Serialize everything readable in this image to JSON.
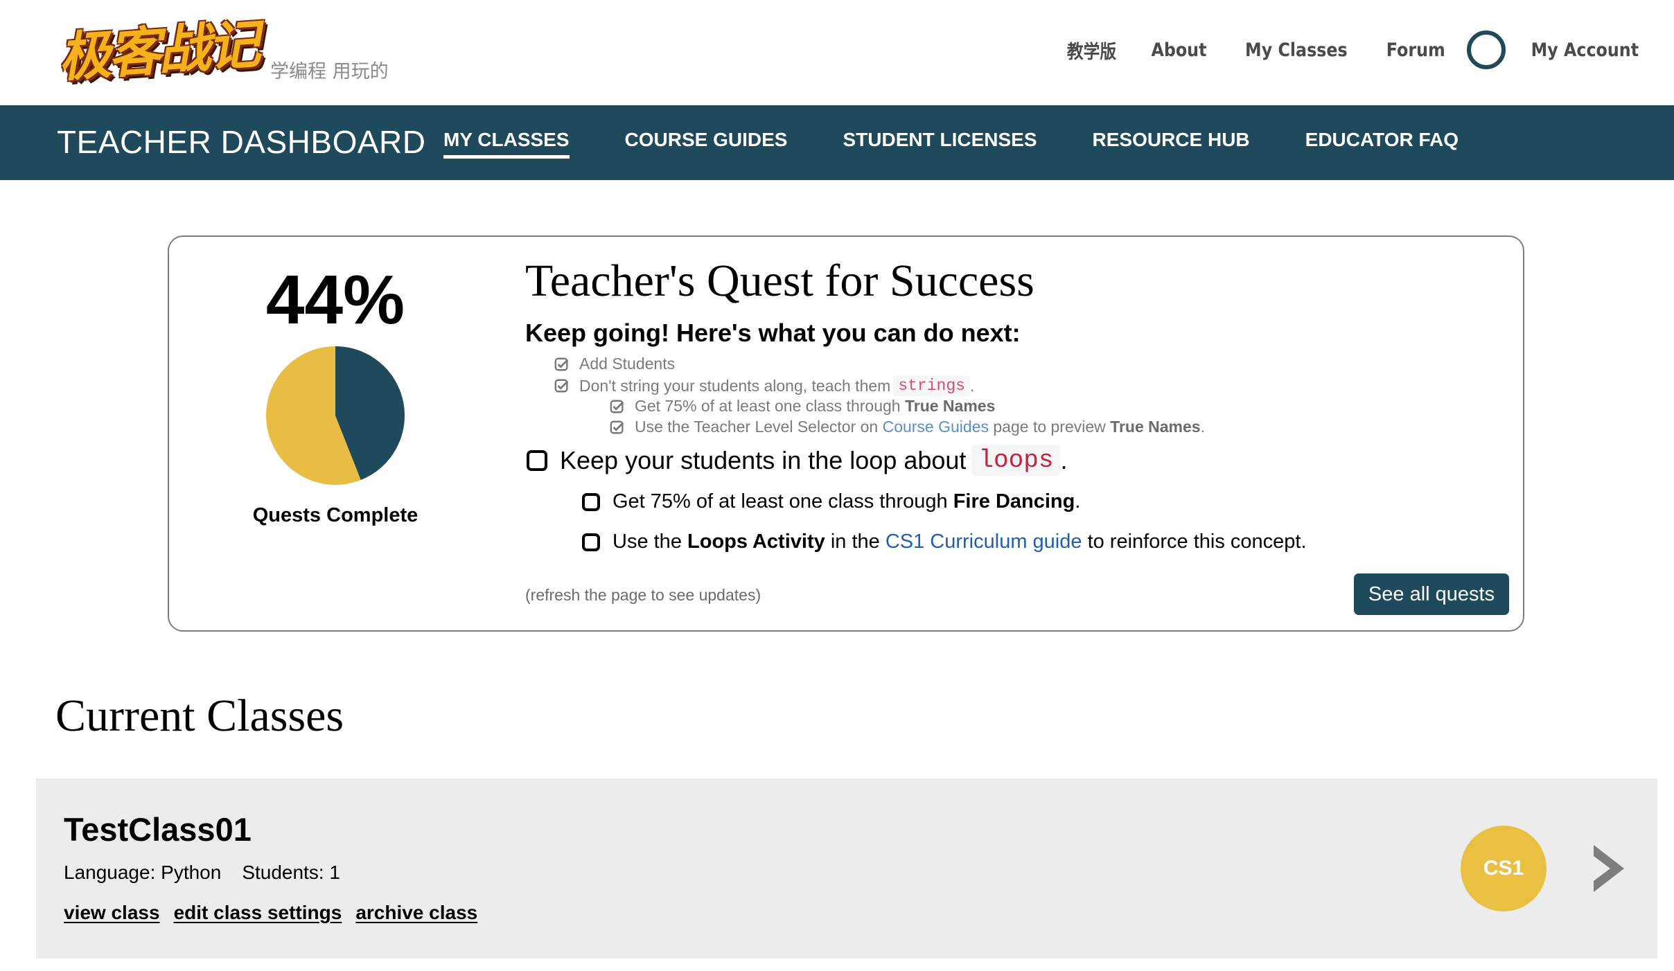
{
  "header": {
    "logo_text": "极客战记",
    "tagline": "学编程 用玩的",
    "nav": [
      "教学版",
      "About",
      "My Classes",
      "Forum"
    ],
    "account_label": "My Account"
  },
  "dashboard": {
    "title": "TEACHER DASHBOARD",
    "links": [
      "MY CLASSES",
      "COURSE GUIDES",
      "STUDENT LICENSES",
      "RESOURCE HUB",
      "EDUCATOR FAQ"
    ],
    "active_link": "MY CLASSES"
  },
  "quest": {
    "percent": "44%",
    "progress_fraction": 0.44,
    "progress_label": "Quests Complete",
    "title": "Teacher's Quest for Success",
    "subtitle": "Keep going! Here's what you can do next:",
    "done1": "Add Students",
    "done2_text": "Don't string your students along, teach them",
    "done2_code": "strings",
    "done2_end": ".",
    "done2a_text": "Get 75% of at least one class through",
    "done2a_bold": "True Names",
    "done2b_pre": "Use the Teacher Level Selector on",
    "done2b_link": "Course Guides",
    "done2b_mid": "page to preview",
    "done2b_bold": "True Names",
    "done2b_end": ".",
    "todo_text": "Keep your students in the loop about",
    "todo_code": "loops",
    "todo_end": ".",
    "todo_a_text": "Get 75% of at least one class through",
    "todo_a_bold": "Fire Dancing",
    "todo_a_end": ".",
    "todo_b_pre": "Use the",
    "todo_b_bold": "Loops Activity",
    "todo_b_mid": "in the",
    "todo_b_link": "CS1 Curriculum guide",
    "todo_b_end": "to reinforce this concept.",
    "refresh_note": "(refresh the page to see updates)",
    "see_all": "See all quests"
  },
  "classes": {
    "heading": "Current Classes",
    "items": [
      {
        "name": "TestClass01",
        "language": "Language: Python",
        "students": "Students: 1",
        "view": "view class",
        "edit": "edit class settings",
        "archive": "archive class",
        "badge": "CS1"
      }
    ]
  },
  "colors": {
    "brand_dark": "#1f4a5c",
    "pie_yellow": "#e9bd44",
    "badge_yellow": "#eac043",
    "card_bg": "#ececec"
  }
}
